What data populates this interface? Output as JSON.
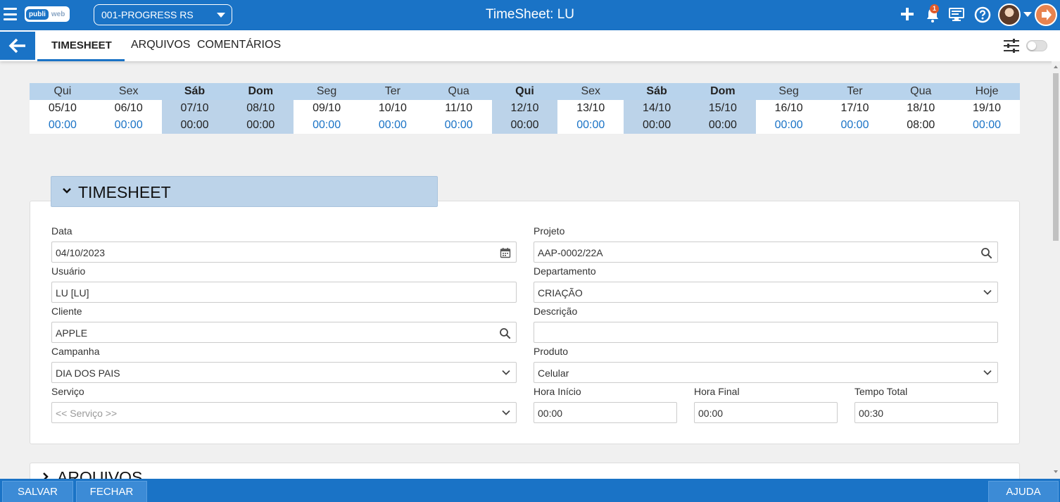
{
  "topbar": {
    "logo_text_1": "publi",
    "logo_text_2": "web",
    "company": "001-PROGRESS RS",
    "title": "TimeSheet: LU",
    "notification_count": "1"
  },
  "tabs": [
    {
      "label": "TIMESHEET",
      "active": true
    },
    {
      "label": "ARQUIVOS",
      "active": false
    },
    {
      "label": "COMENTÁRIOS",
      "active": false
    }
  ],
  "calendar": [
    {
      "weekday": "Qui",
      "date": "05/10",
      "hours": "00:00"
    },
    {
      "weekday": "Sex",
      "date": "06/10",
      "hours": "00:00"
    },
    {
      "weekday": "Sáb",
      "date": "07/10",
      "hours": "00:00"
    },
    {
      "weekday": "Dom",
      "date": "08/10",
      "hours": "00:00"
    },
    {
      "weekday": "Seg",
      "date": "09/10",
      "hours": "00:00"
    },
    {
      "weekday": "Ter",
      "date": "10/10",
      "hours": "00:00"
    },
    {
      "weekday": "Qua",
      "date": "11/10",
      "hours": "00:00"
    },
    {
      "weekday": "Qui",
      "date": "12/10",
      "hours": "00:00"
    },
    {
      "weekday": "Sex",
      "date": "13/10",
      "hours": "00:00"
    },
    {
      "weekday": "Sáb",
      "date": "14/10",
      "hours": "00:00"
    },
    {
      "weekday": "Dom",
      "date": "15/10",
      "hours": "00:00"
    },
    {
      "weekday": "Seg",
      "date": "16/10",
      "hours": "00:00"
    },
    {
      "weekday": "Ter",
      "date": "17/10",
      "hours": "00:00"
    },
    {
      "weekday": "Qua",
      "date": "18/10",
      "hours": "08:00"
    },
    {
      "weekday": "Hoje",
      "date": "19/10",
      "hours": "00:00"
    }
  ],
  "section": {
    "title": "TIMESHEET",
    "collapsed_title": "ARQUIVOS"
  },
  "form": {
    "data_label": "Data",
    "data_value": "04/10/2023",
    "usuario_label": "Usuário",
    "usuario_value": "LU [LU]",
    "cliente_label": "Cliente",
    "cliente_value": "APPLE",
    "campanha_label": "Campanha",
    "campanha_value": "DIA DOS PAIS",
    "servico_label": "Serviço",
    "servico_placeholder": "<< Serviço >>",
    "projeto_label": "Projeto",
    "projeto_value": "AAP-0002/22A",
    "departamento_label": "Departamento",
    "departamento_value": "CRIAÇÃO",
    "descricao_label": "Descrição",
    "descricao_value": "",
    "produto_label": "Produto",
    "produto_value": "Celular",
    "hora_inicio_label": "Hora Início",
    "hora_inicio_value": "00:00",
    "hora_final_label": "Hora Final",
    "hora_final_value": "00:00",
    "tempo_total_label": "Tempo Total",
    "tempo_total_value": "00:30"
  },
  "bottombar": {
    "save": "SALVAR",
    "close": "FECHAR",
    "help": "AJUDA"
  },
  "colors": {
    "primary": "#1a73c6",
    "header_blue": "#bcd3e9",
    "accent_orange": "#e8834f"
  }
}
